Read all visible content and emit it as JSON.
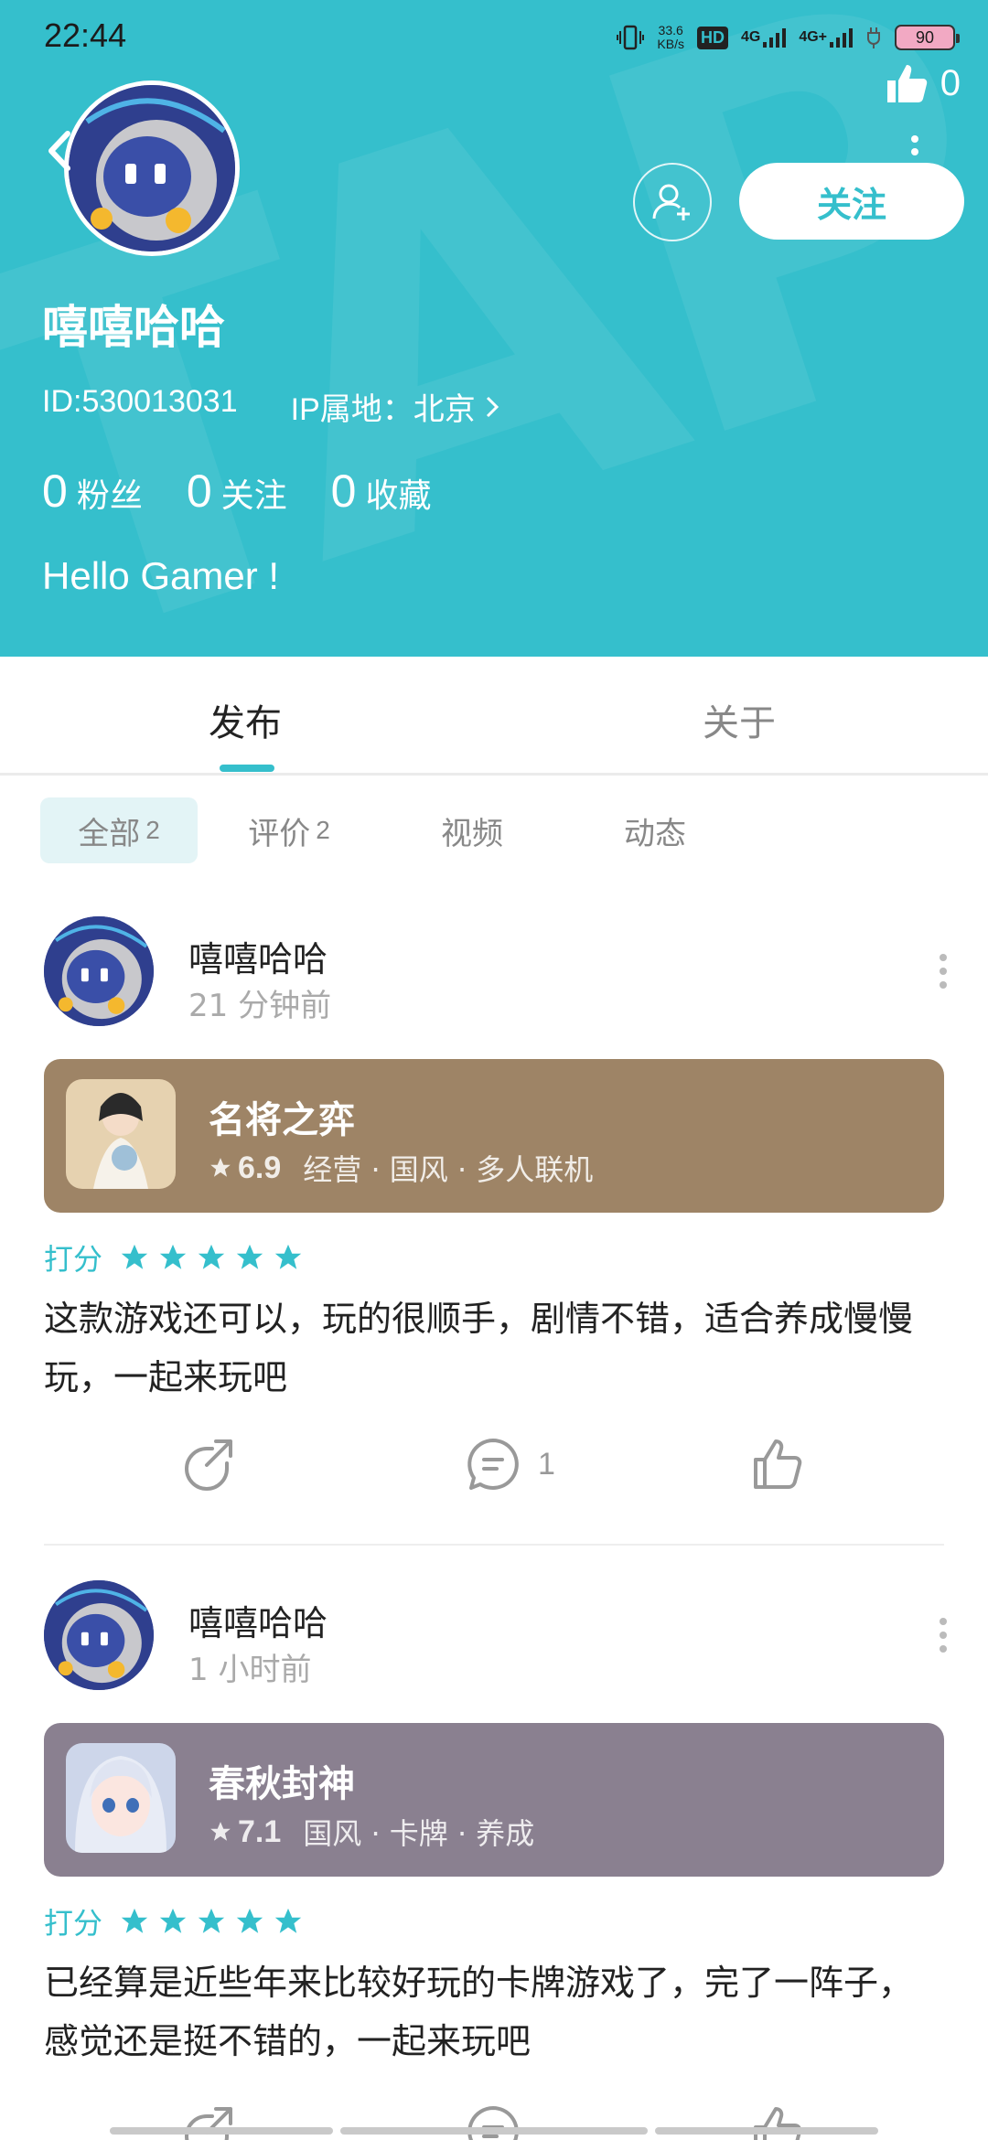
{
  "status_bar": {
    "time": "22:44",
    "net_speed_value": "33.6",
    "net_speed_unit": "KB/s",
    "hd_label": "HD",
    "signal1": "4G",
    "signal2": "4G+",
    "battery": "90"
  },
  "header": {
    "like_count": "0",
    "follow_label": "关注",
    "username": "嘻嘻哈哈",
    "user_id": "ID:530013031",
    "ip_location": "IP属地：北京",
    "stats": [
      {
        "value": "0",
        "label": "粉丝"
      },
      {
        "value": "0",
        "label": "关注"
      },
      {
        "value": "0",
        "label": "收藏"
      }
    ],
    "bio": "Hello Gamer !"
  },
  "tabs": [
    {
      "label": "发布",
      "active": true
    },
    {
      "label": "关于",
      "active": false
    }
  ],
  "filters": [
    {
      "label": "全部",
      "count": "2",
      "active": true
    },
    {
      "label": "评价",
      "count": "2",
      "active": false
    },
    {
      "label": "视频",
      "count": "",
      "active": false
    },
    {
      "label": "动态",
      "count": "",
      "active": false
    }
  ],
  "posts": [
    {
      "author": "嘻嘻哈哈",
      "time": "21 分钟前",
      "game": {
        "title": "名将之弈",
        "score": "6.9",
        "tags": "经营 · 国风 · 多人联机",
        "card_color": "#9e8466"
      },
      "rating_label": "打分",
      "rating_stars": 5,
      "text": "这款游戏还可以，玩的很顺手，剧情不错，适合养成慢慢玩，一起来玩吧",
      "comment_count": "1"
    },
    {
      "author": "嘻嘻哈哈",
      "time": "1 小时前",
      "game": {
        "title": "春秋封神",
        "score": "7.1",
        "tags": "国风 · 卡牌 · 养成",
        "card_color": "#8a8090"
      },
      "rating_label": "打分",
      "rating_stars": 5,
      "text": "已经算是近些年来比较好玩的卡牌游戏了，完了一阵子，感觉还是挺不错的，一起来玩吧",
      "comment_count": ""
    }
  ],
  "colors": {
    "accent": "#35bfcc",
    "header_bg": "#35bfcc"
  }
}
